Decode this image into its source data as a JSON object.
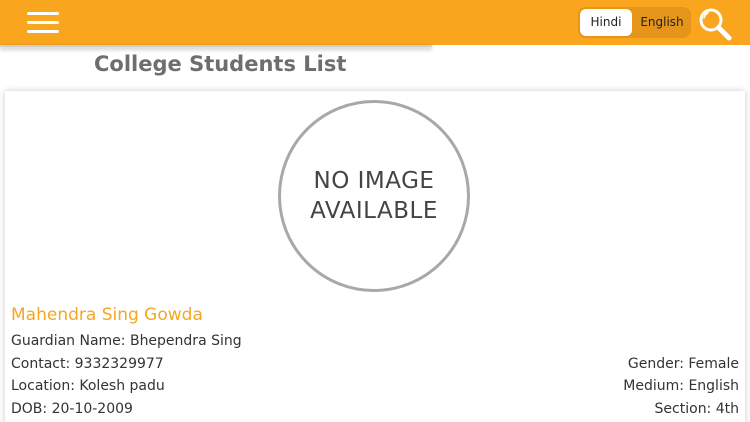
{
  "header": {
    "languages": {
      "hindi": "Hindi",
      "english": "English"
    }
  },
  "page": {
    "title": "College Students List"
  },
  "card": {
    "placeholder": {
      "line1": "NO IMAGE",
      "line2": "AVAILABLE"
    },
    "name": "Mahendra Sing Gowda",
    "guardian": "Guardian Name: Bhependra Sing",
    "contact": "Contact: 9332329977",
    "location": "Location: Kolesh padu",
    "dob": "DOB: 20-10-2009",
    "gender": "Gender: Female",
    "medium": "Medium: English",
    "section": "Section: 4th"
  },
  "colors": {
    "header_bg": "#f9a51e",
    "accent_name": "#f5a623"
  },
  "icons": {
    "menu": "hamburger-menu-icon",
    "search": "search-icon"
  }
}
